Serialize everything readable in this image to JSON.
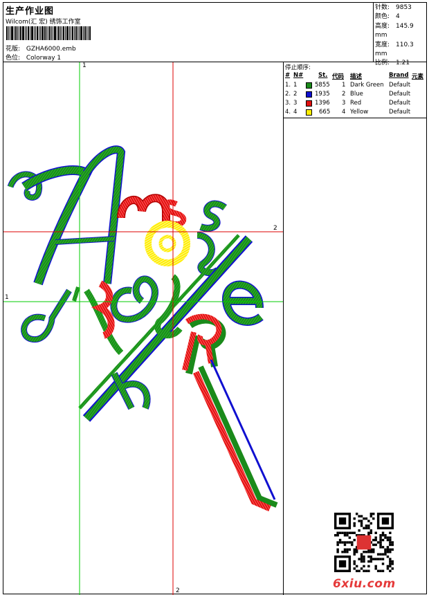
{
  "header": {
    "title": "生产作业图",
    "subtitle": "Wilcom(汇 宏) 绣饰工作室",
    "design_label": "花版:",
    "design_value": "GZHA6000.emb",
    "colorway_label": "色位:",
    "colorway_value": "Colorway 1"
  },
  "stats": [
    {
      "label": "针数:",
      "value": "9853"
    },
    {
      "label": "颜色:",
      "value": "4"
    },
    {
      "label": "高度:",
      "value": "145.9 mm"
    },
    {
      "label": "宽度:",
      "value": "110.3 mm"
    },
    {
      "label": "比例:",
      "value": "1.21"
    }
  ],
  "stop_sequence": {
    "caption": "停止顺序:",
    "headers": [
      "#",
      "N#",
      "St.",
      "代码",
      "描述",
      "Brand",
      "元素"
    ],
    "rows": [
      {
        "idx": "1.",
        "n": "1",
        "color": "#1a8a1a",
        "stitches": "5855",
        "code": "1",
        "desc": "Dark Green",
        "brand": "Default"
      },
      {
        "idx": "2.",
        "n": "2",
        "color": "#1010d0",
        "stitches": "1935",
        "code": "2",
        "desc": "Blue",
        "brand": "Default"
      },
      {
        "idx": "3.",
        "n": "3",
        "color": "#e01010",
        "stitches": "1396",
        "code": "3",
        "desc": "Red",
        "brand": "Default"
      },
      {
        "idx": "4.",
        "n": "4",
        "color": "#ffee00",
        "stitches": "665",
        "code": "4",
        "desc": "Yellow",
        "brand": "Default"
      }
    ]
  },
  "guides": {
    "v1_label": "1",
    "v2_label": "2",
    "h1_label": "1",
    "h2_label": "2",
    "color_1": "#00cc00",
    "color_2": "#dd0000"
  },
  "watermark": "6xiu.com"
}
